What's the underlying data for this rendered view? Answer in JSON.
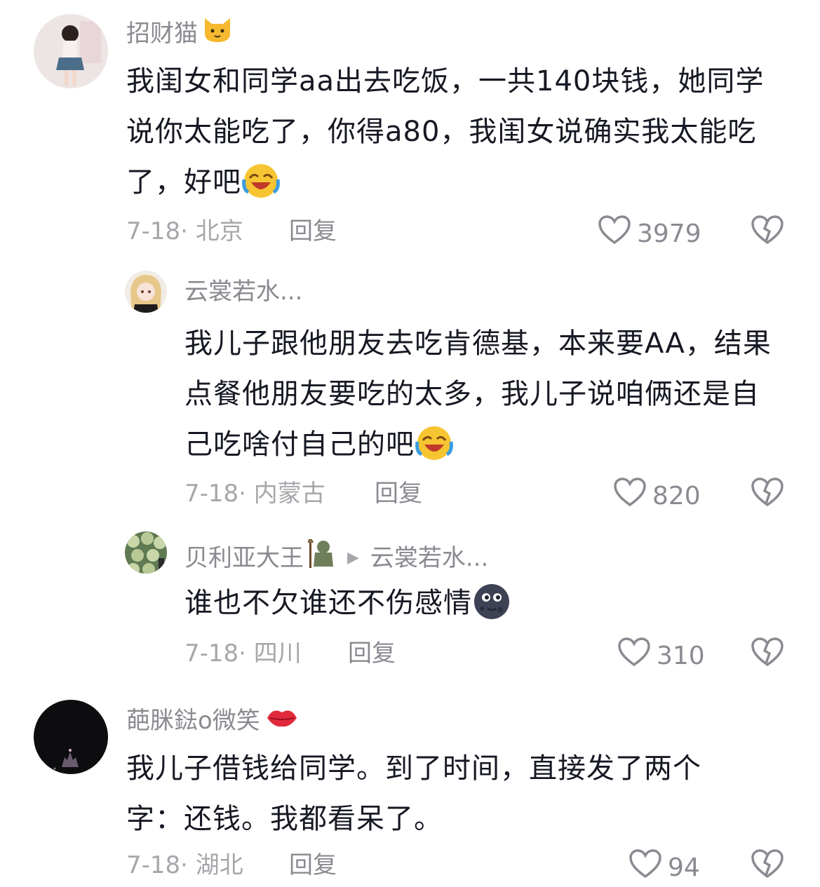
{
  "comments": [
    {
      "username": "招财猫",
      "username_badge": "cat-face-emoji",
      "text": "我闺女和同学aa出去吃饭，一共140块钱，她同学说你太能吃了，你得a80，我闺女说确实我太能吃了，好吧",
      "text_emoji": "laughing-crying-emoji",
      "date_location": "7-18· 北京",
      "reply_label": "回复",
      "likes": "3979",
      "avatar": "girl-photo-avatar"
    },
    {
      "username": "云裳若水...",
      "text": "我儿子跟他朋友去吃肯德基，本来要AA，结果点餐他朋友要吃的太多，我儿子说咱俩还是自己吃啥付自己的吧",
      "text_emoji": "laughing-crying-emoji",
      "date_location": "7-18· 内蒙古",
      "reply_label": "回复",
      "likes": "820",
      "avatar": "anime-girl-avatar"
    },
    {
      "username": "贝利亚大王",
      "username_badge": "troll-emoji",
      "reply_to": "云裳若水...",
      "text": "谁也不欠谁还不伤感情",
      "text_emoji": "new-moon-face-emoji",
      "date_location": "7-18· 四川",
      "reply_label": "回复",
      "likes": "310",
      "avatar": "melon-field-avatar"
    },
    {
      "username": "葩脒鍅o微笑",
      "username_badge": "kiss-lips-emoji",
      "text": "我儿子借钱给同学。到了时间，直接发了两个字：还钱。我都看呆了。",
      "date_location": "7-18· 湖北",
      "reply_label": "回复",
      "likes": "94",
      "avatar": "night-castle-avatar"
    }
  ],
  "colors": {
    "text": "#161823",
    "secondary": "#8a8b91",
    "tertiary": "#a6a7ab",
    "background": "#ffffff"
  }
}
